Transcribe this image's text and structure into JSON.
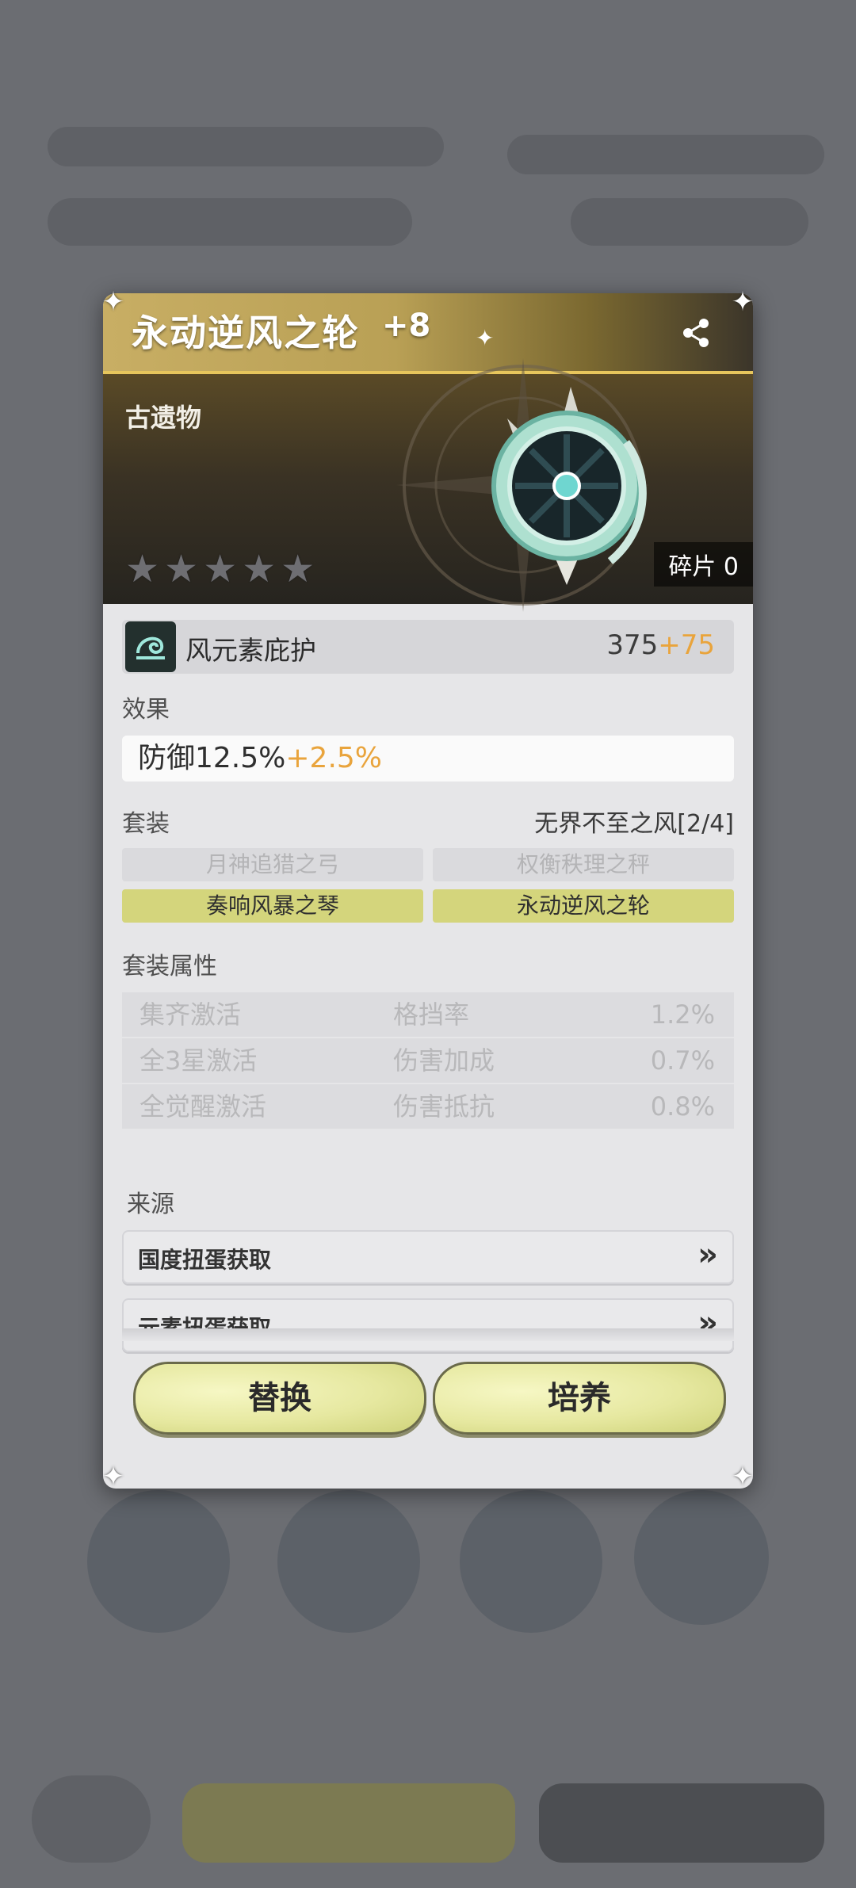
{
  "item": {
    "name": "永动逆风之轮",
    "level": "+8",
    "type": "古遗物",
    "fragments": "碎片 0",
    "star_count": 5
  },
  "main_stat": {
    "name": "风元素庇护",
    "base": "375",
    "bonus": "+75"
  },
  "effect": {
    "label": "效果",
    "text": "防御12.5%",
    "bonus": "+2.5%"
  },
  "set": {
    "label": "套装",
    "name": "无界不至之风[2/4]",
    "items": [
      {
        "label": "月神追猎之弓",
        "active": false
      },
      {
        "label": "权衡秩理之秤",
        "active": false
      },
      {
        "label": "奏响风暴之琴",
        "active": true
      },
      {
        "label": "永动逆风之轮",
        "active": true
      }
    ]
  },
  "set_attributes": {
    "label": "套装属性",
    "rows": [
      {
        "condition": "集齐激活",
        "stat": "格挡率",
        "value": "1.2%"
      },
      {
        "condition": "全3星激活",
        "stat": "伤害加成",
        "value": "0.7%"
      },
      {
        "condition": "全觉醒激活",
        "stat": "伤害抵抗",
        "value": "0.8%"
      }
    ]
  },
  "source": {
    "label": "来源",
    "options": [
      "国度扭蛋获取",
      "元素扭蛋获取"
    ]
  },
  "buttons": {
    "replace": "替换",
    "cultivate": "培养"
  },
  "colors": {
    "accent_gold": "#e7c65c",
    "bonus_orange": "#e9a43c",
    "active_set": "#d4d57c"
  }
}
